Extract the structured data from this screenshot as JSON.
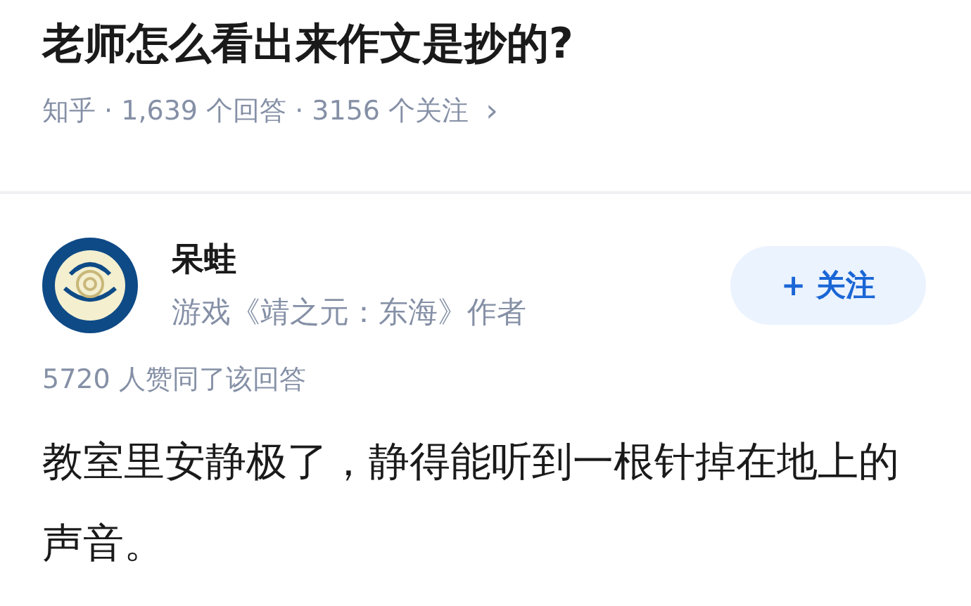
{
  "question": {
    "title": "老师怎么看出来作文是抄的?",
    "meta": "知乎 · 1,639 个回答 · 3156 个关注",
    "chevron": "›"
  },
  "answer": {
    "author": "呆蛙",
    "bio": "游戏《靖之元：东海》作者",
    "follow_button": "+ 关注",
    "votes": "5720 人赞同了该回答",
    "body": "教室里安静极了，静得能听到一根针掉在地上的声音。"
  }
}
